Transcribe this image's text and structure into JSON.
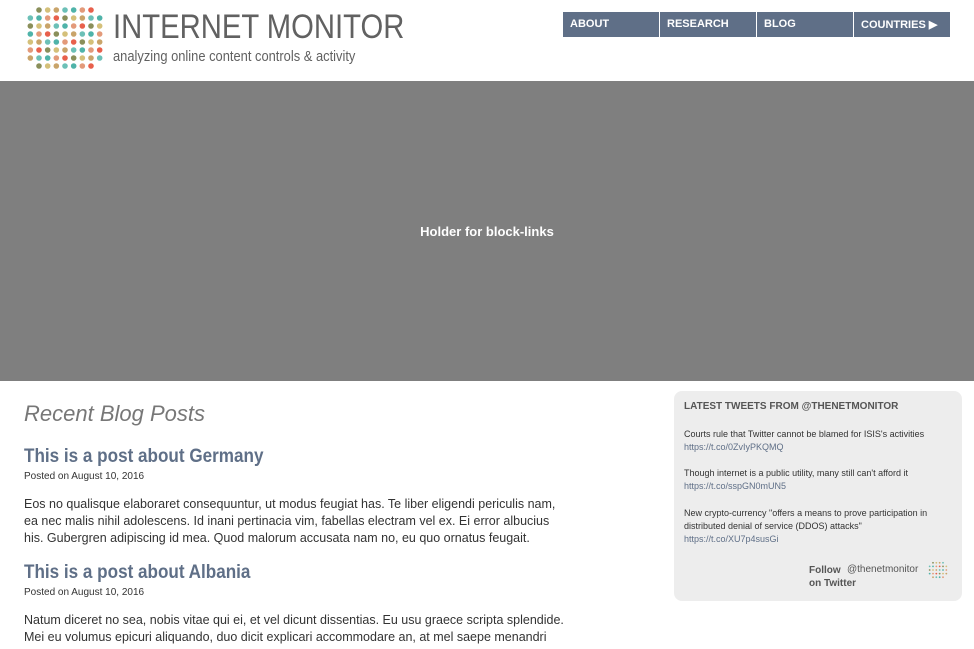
{
  "header": {
    "title": "INTERNET MONITOR",
    "subtitle": "analyzing online content controls & activity",
    "nav": [
      "ABOUT",
      "RESEARCH",
      "BLOG",
      "COUNTRIES ▶"
    ]
  },
  "hero": {
    "text": "Holder for block-links"
  },
  "blog": {
    "heading": "Recent Blog Posts",
    "posts": [
      {
        "title": "This is a post about Germany",
        "date": "Posted on August 10, 2016",
        "body": "Eos no qualisque elaboraret consequuntur, ut modus feugiat has. Te liber eligendi periculis nam, ea nec malis nihil adolescens. Id inani pertinacia vim, fabellas electram vel ex. Ei error albucius his. Gubergren adipiscing id mea. Quod malorum accusata nam no, eu quo ornatus feugait."
      },
      {
        "title": "This is a post about Albania",
        "date": "Posted on August 10, 2016",
        "body": "Natum diceret no sea, nobis vitae qui ei, et vel dicunt dissentias. Eu usu graece scripta splendide. Mei eu volumus epicuri aliquando, duo dicit explicari accommodare an, at mel saepe menandri"
      }
    ]
  },
  "tweets": {
    "heading": "LATEST TWEETS FROM @THENETMONITOR",
    "items": [
      {
        "text": "Courts rule that Twitter cannot be blamed for ISIS's activities",
        "link": "https://t.co/0ZvIyPKQMQ"
      },
      {
        "text": "Though internet is a public utility, many still can't afford it",
        "link": "https://t.co/sspGN0mUN5"
      },
      {
        "text": "New crypto-currency \"offers a means to prove participation in distributed denial of service (DDOS) attacks\"",
        "link": "https://t.co/XU7p4susGi"
      }
    ],
    "follow_line1": "Follow",
    "follow_line2": "on Twitter",
    "handle": "@thenetmonitor"
  },
  "colors": {
    "nav": "#5f6f87",
    "hero": "#7f7f7f",
    "panel": "#ededed"
  }
}
